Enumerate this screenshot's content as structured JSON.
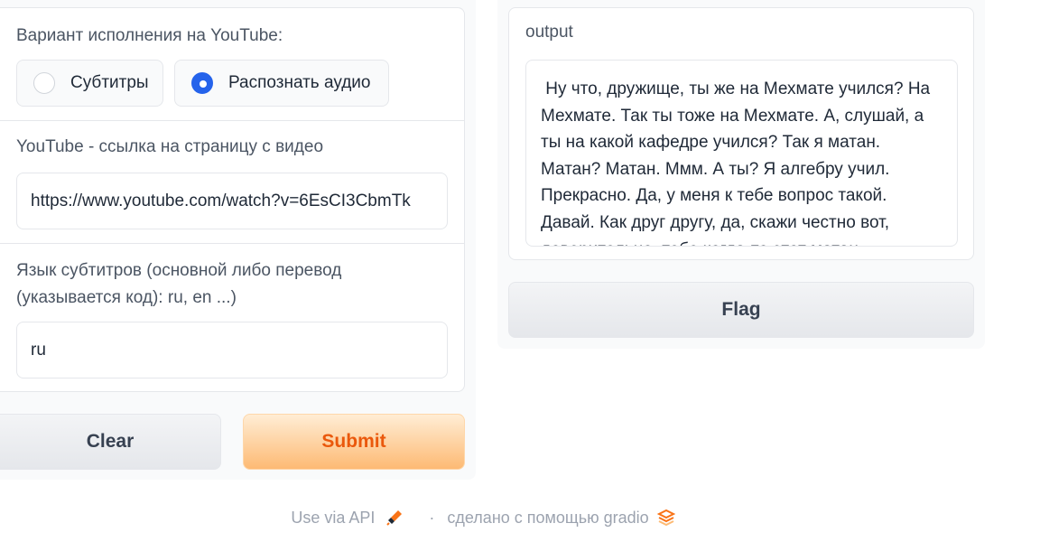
{
  "inputs": {
    "variant_label": "Вариант исполнения на YouTube:",
    "radio_options": [
      {
        "label": "Субтитры",
        "selected": false
      },
      {
        "label": "Распознать аудио",
        "selected": true
      }
    ],
    "url_label": "YouTube - ссылка на страницу с видео",
    "url_value": "https://www.youtube.com/watch?v=6EsCI3CbmTk",
    "lang_label_line1": "Язык субтитров (основной либо перевод",
    "lang_label_line2": "(указывается код): ru, en ...)",
    "lang_value": "ru"
  },
  "buttons": {
    "clear": "Clear",
    "submit": "Submit",
    "flag": "Flag"
  },
  "output": {
    "label": "output",
    "text": " Ну что, дружище, ты же на Мехмате учился? На Мехмате. Так ты тоже на Мехмате. А, слушай, а ты на какой кафедре учился? Так я матан. Матан? Матан. Ммм. А ты? Я алгебру учил. Прекрасно. Да, у меня к тебе вопрос такой. Давай. Как друг другу, да, скажи честно вот, доверительно, тебе когда-то этот матан"
  },
  "footer": {
    "api_link": "Use via API",
    "separator": "·",
    "made_with": "сделано с помощью gradio"
  },
  "colors": {
    "accent_orange": "#ea580c",
    "radio_blue": "#2563eb"
  }
}
